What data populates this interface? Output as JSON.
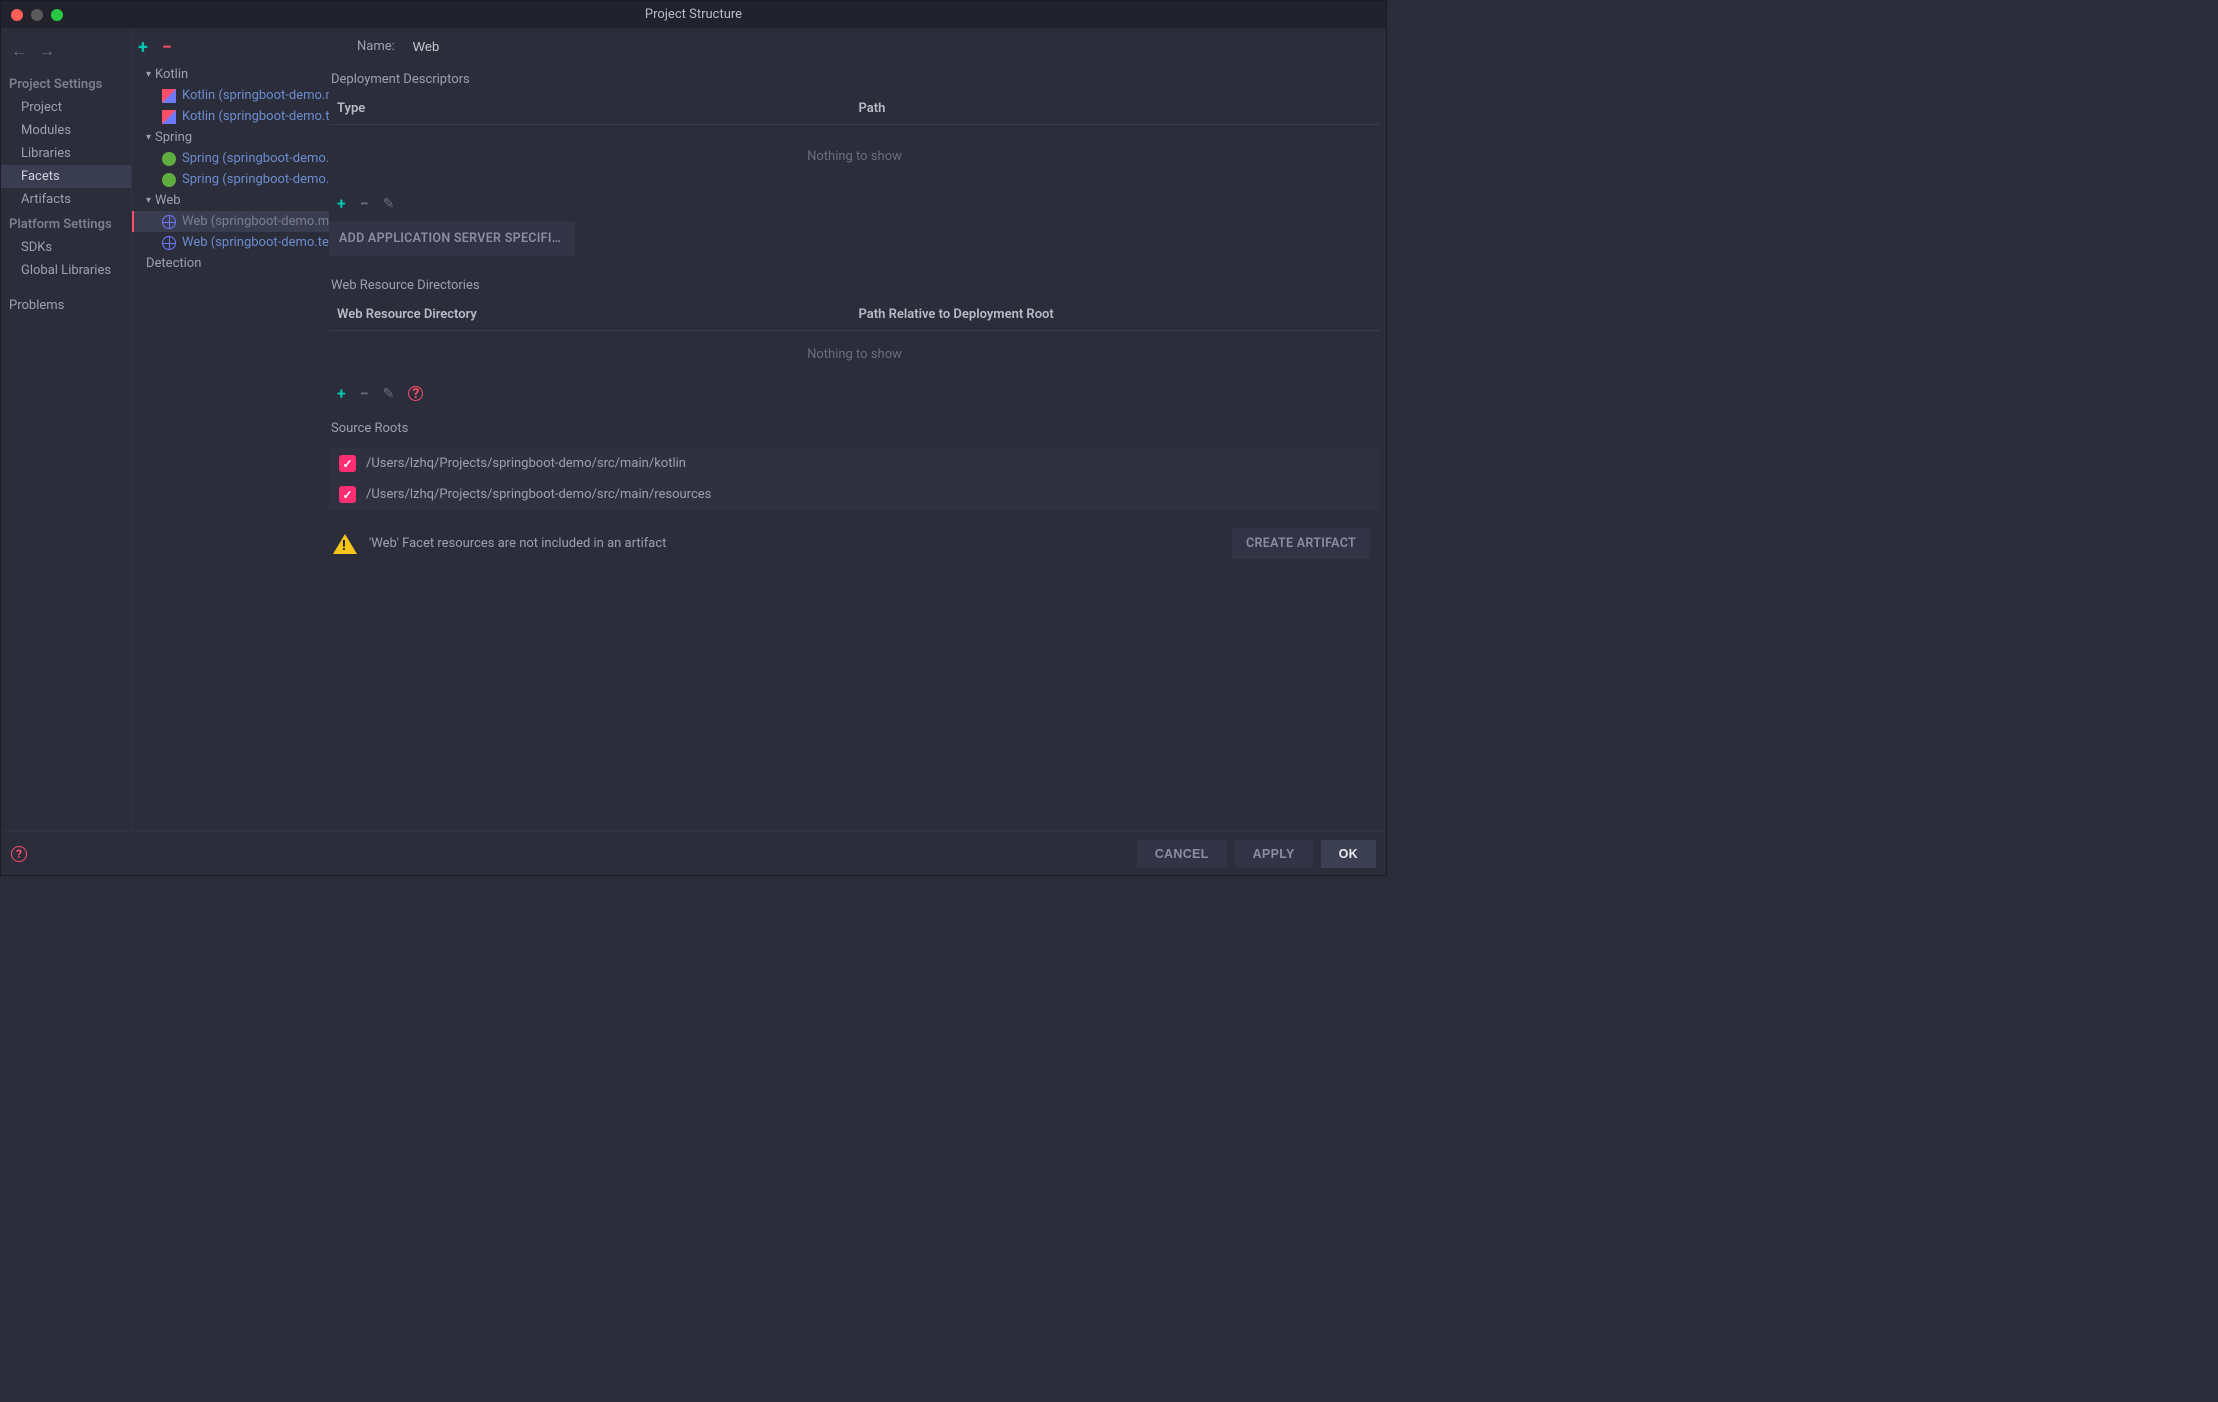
{
  "title": "Project Structure",
  "sidebar": {
    "section1": "Project Settings",
    "items1": [
      "Project",
      "Modules",
      "Libraries",
      "Facets",
      "Artifacts"
    ],
    "section2": "Platform Settings",
    "items2": [
      "SDKs",
      "Global Libraries"
    ],
    "items3": [
      "Problems"
    ]
  },
  "facets": {
    "groups": [
      {
        "label": "Kotlin",
        "children": [
          "Kotlin (springboot-demo.main)",
          "Kotlin (springboot-demo.test)"
        ]
      },
      {
        "label": "Spring",
        "children": [
          "Spring (springboot-demo.main)",
          "Spring (springboot-demo.test)"
        ]
      },
      {
        "label": "Web",
        "children": [
          "Web (springboot-demo.main)",
          "Web (springboot-demo.test)"
        ]
      }
    ],
    "detection": "Detection"
  },
  "main": {
    "name_label": "Name:",
    "name_value": "Web",
    "section_deploy": "Deployment Descriptors",
    "col_type": "Type",
    "col_path": "Path",
    "nothing": "Nothing to show",
    "add_descriptor": "ADD APPLICATION SERVER SPECIFIC DESCRIPTOR...",
    "section_webres": "Web Resource Directories",
    "col_wrd": "Web Resource Directory",
    "col_prdr": "Path Relative to Deployment Root",
    "section_sources": "Source Roots",
    "sources": [
      "/Users/lzhq/Projects/springboot-demo/src/main/kotlin",
      "/Users/lzhq/Projects/springboot-demo/src/main/resources"
    ],
    "warning": "'Web' Facet resources are not included in an artifact",
    "create_artifact": "CREATE ARTIFACT"
  },
  "footer": {
    "cancel": "CANCEL",
    "apply": "APPLY",
    "ok": "OK"
  }
}
